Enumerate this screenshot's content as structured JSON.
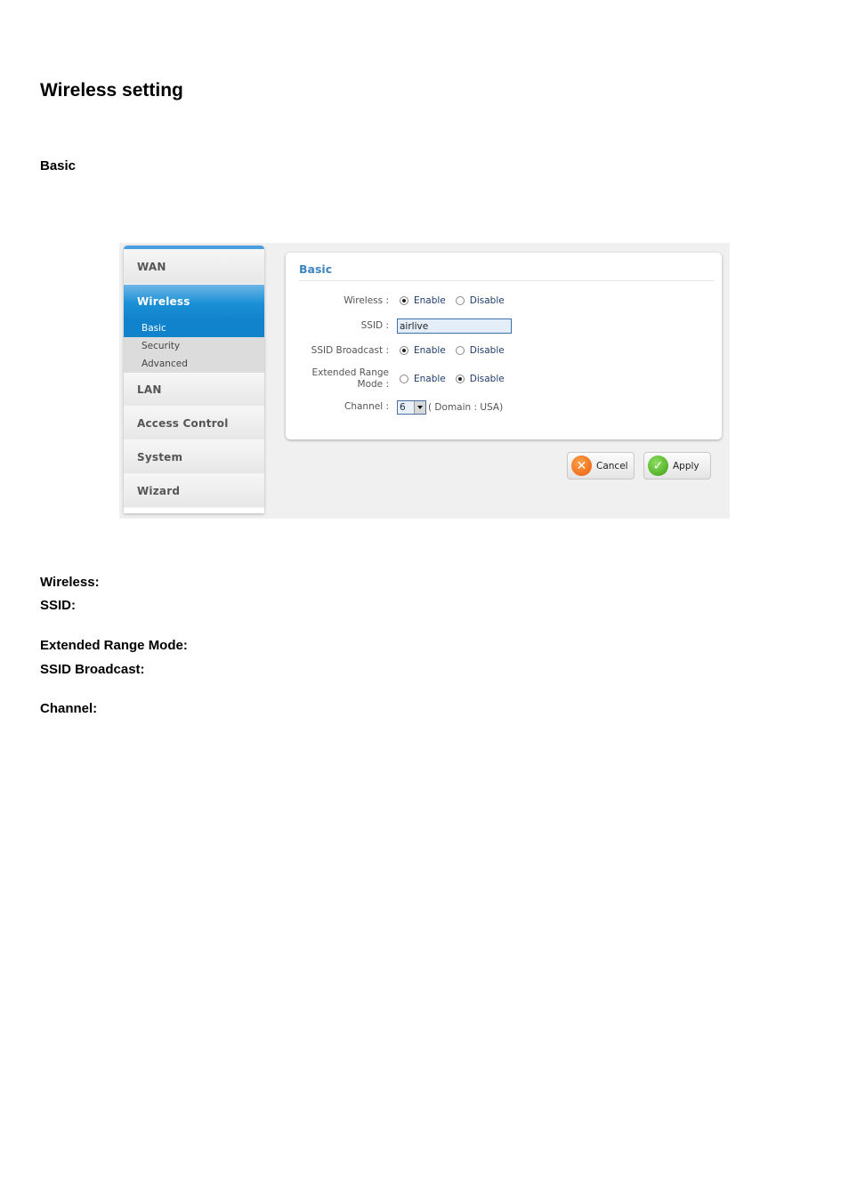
{
  "document": {
    "title": "Wireless setting",
    "subheading": "Basic"
  },
  "sidebar": {
    "items": [
      {
        "label": "WAN",
        "active": false
      },
      {
        "label": "Wireless",
        "active": true
      },
      {
        "label": "LAN",
        "active": false
      },
      {
        "label": "Access Control",
        "active": false
      },
      {
        "label": "System",
        "active": false
      },
      {
        "label": "Wizard",
        "active": false
      }
    ],
    "wireless_subitems": [
      {
        "label": "Basic",
        "active": true
      },
      {
        "label": "Security",
        "active": false
      },
      {
        "label": "Advanced",
        "active": false
      }
    ]
  },
  "panel": {
    "title": "Basic",
    "wireless": {
      "label": "Wireless :",
      "options": [
        "Enable",
        "Disable"
      ],
      "selected": "Enable"
    },
    "ssid": {
      "label": "SSID :",
      "value": "airlive"
    },
    "ssid_broadcast": {
      "label": "SSID Broadcast :",
      "options": [
        "Enable",
        "Disable"
      ],
      "selected": "Enable"
    },
    "extended_range": {
      "label_line1": "Extended Range",
      "label_line2": "Mode :",
      "options": [
        "Enable",
        "Disable"
      ],
      "selected": "Disable"
    },
    "channel": {
      "label": "Channel :",
      "value": "6",
      "domain_note": "( Domain : USA)"
    }
  },
  "buttons": {
    "cancel": "Cancel",
    "apply": "Apply"
  },
  "colors": {
    "accent_blue": "#1183cc",
    "title_blue": "#3d85c0",
    "cancel_orange": "#e85a0a",
    "apply_green": "#3a9e12"
  },
  "fields": [
    {
      "label": "Wireless:"
    },
    {
      "label": "SSID:"
    },
    {
      "label": "Extended Range Mode:"
    },
    {
      "label": "SSID Broadcast:"
    },
    {
      "label": "Channel:"
    }
  ]
}
